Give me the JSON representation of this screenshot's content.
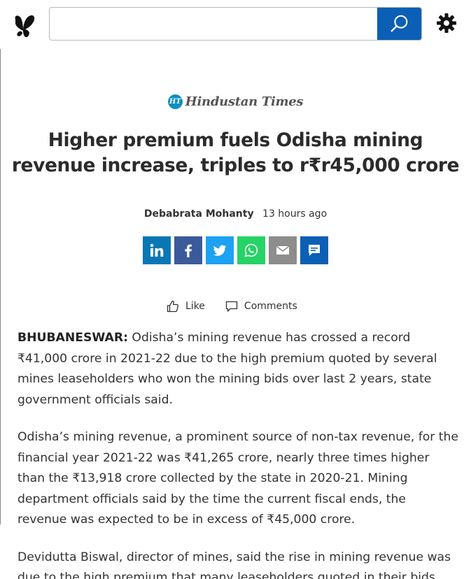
{
  "toolbar": {
    "search_placeholder": "",
    "search_value": ""
  },
  "article": {
    "source": "Hindustan Times",
    "source_badge": "HT",
    "headline": "Higher premium fuels Odisha mining revenue increase, triples to r₹r45,000 crore",
    "author": "Debabrata Mohanty",
    "time": "13 hours ago",
    "like_label": "Like",
    "comments_label": "Comments",
    "dateline": "BHUBANESWAR:",
    "paragraph1": " Odisha’s mining revenue has crossed a record ₹41,000 crore in 2021-22 due to the high premium quoted by several mines leaseholders who won the mining bids over last 2 years, state government officials said.",
    "paragraph2": "Odisha’s mining revenue, a prominent source of non-tax revenue, for the financial year 2021-22 was ₹41,265 crore, nearly three times higher than the ₹13,918 crore collected by the state in 2020-21. Mining department officials said by the time the current fiscal ends, the revenue was expected to be in excess of ₹45,000 crore.",
    "paragraph3": "Devidutta Biswal, director of mines, said the rise in mining revenue was due to the high premium that many leaseholders quoted in their bids"
  },
  "share": {
    "colors": {
      "linkedin": "#0a77b5",
      "facebook": "#3b5a9a",
      "twitter": "#1da1f2",
      "whatsapp": "#25d366",
      "email": "#8d8d8d",
      "sms": "#0b5fb5"
    }
  },
  "icons": [
    "butterfly-logo-icon",
    "search-icon",
    "gear-icon",
    "linkedin-icon",
    "facebook-icon",
    "twitter-icon",
    "whatsapp-icon",
    "email-icon",
    "message-icon",
    "like-icon",
    "comment-icon"
  ]
}
